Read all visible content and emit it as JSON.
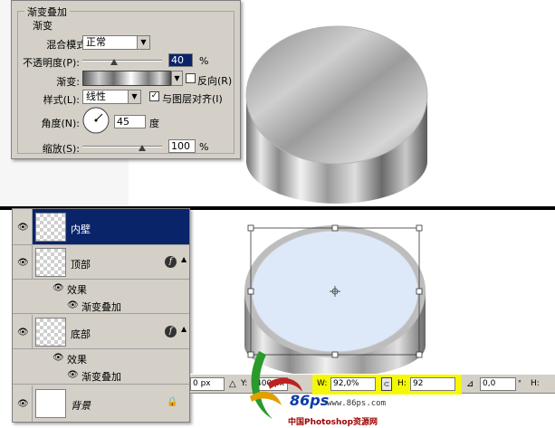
{
  "gradient_overlay": {
    "panel_title": "渐变叠加",
    "group_title": "渐变",
    "blend_mode_label": "混合模式:",
    "blend_mode_value": "正常",
    "opacity_label": "不透明度(P):",
    "opacity_value": "40",
    "percent": "%",
    "gradient_label": "渐变:",
    "reverse_label": "反向(R)",
    "style_label": "样式(L):",
    "style_value": "线性",
    "align_label": "与图层对齐(I)",
    "angle_label": "角度(N):",
    "angle_value": "45",
    "degree": "度",
    "scale_label": "缩放(S):",
    "scale_value": "100",
    "opacity_fraction": 0.4,
    "scale_fraction": 1.0,
    "reverse_checked": false,
    "align_checked": true
  },
  "layers": {
    "items": [
      {
        "name": "内壁",
        "selected": true
      },
      {
        "name": "顶部",
        "effects_label": "效果",
        "effect": "渐变叠加"
      },
      {
        "name": "底部",
        "effects_label": "效果",
        "effect": "渐变叠加"
      },
      {
        "name": "背景"
      }
    ]
  },
  "transform_bar": {
    "x_value": "0 px",
    "y_label": "Y:",
    "y_value": "400 px",
    "w_label": "W:",
    "w_value": "92,0%",
    "h_label": "H:",
    "h_value": "92",
    "angle_value": "0,0",
    "h_skew_label": "H:"
  },
  "logo": {
    "brand": "86ps",
    "url": "www.86ps.com",
    "caption": "中国Photoshop资源网"
  },
  "colors": {
    "panel_bg": "#d4d0c8",
    "selected_layer": "#0a246a",
    "ellipse_fill": "#dde9f8",
    "highlight": "#f4f800"
  }
}
